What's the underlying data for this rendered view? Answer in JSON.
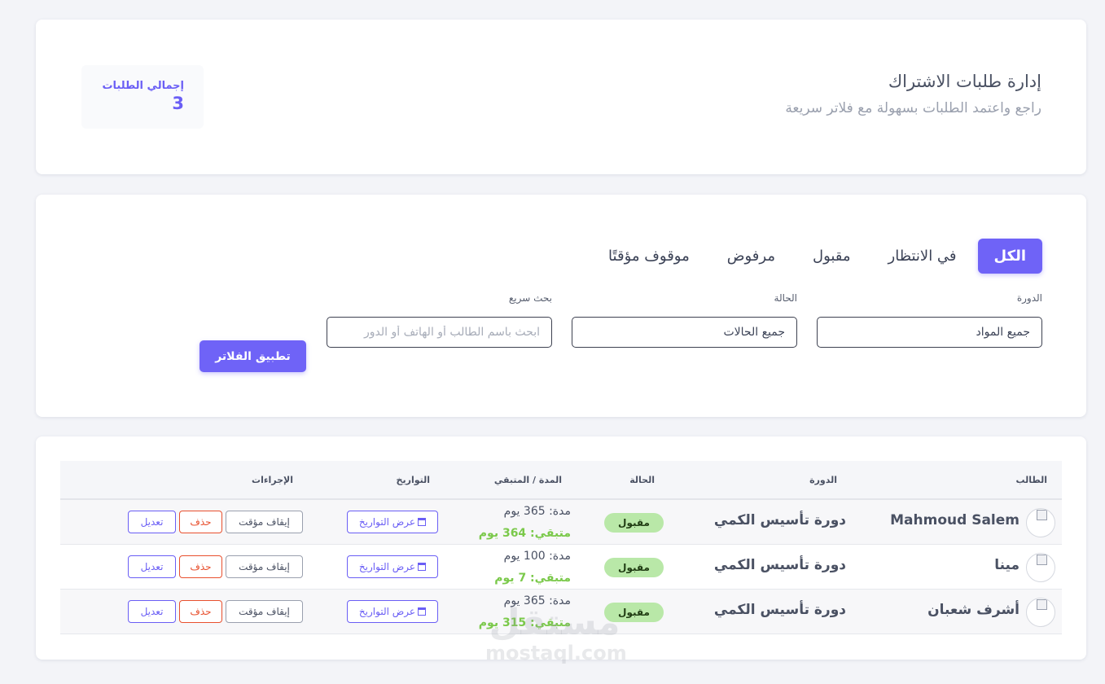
{
  "header": {
    "title": "إدارة طلبات الاشتراك",
    "subtitle": "راجع واعتمد الطلبات بسهولة مع فلاتر سريعة",
    "total_label": "إجمالي الطلبات",
    "total_value": "3"
  },
  "tabs": [
    {
      "label": "الكل",
      "active": true
    },
    {
      "label": "في الانتظار",
      "active": false
    },
    {
      "label": "مقبول",
      "active": false
    },
    {
      "label": "مرفوض",
      "active": false
    },
    {
      "label": "موقوف مؤقتًا",
      "active": false
    }
  ],
  "filters": {
    "course_label": "الدورة",
    "course_value": "جميع المواد",
    "status_label": "الحالة",
    "status_value": "جميع الحالات",
    "search_label": "بحث سريع",
    "search_placeholder": "ابحث باسم الطالب أو الهاتف أو الدور",
    "apply_label": "تطبيق الفلاتر"
  },
  "table": {
    "headers": {
      "student": "الطالب",
      "course": "الدورة",
      "status": "الحالة",
      "duration": "المدة / المتبقي",
      "dates": "التواريخ",
      "actions": "الإجراءات"
    },
    "rows": [
      {
        "student": "Mahmoud Salem",
        "course": "دورة تأسيس الكمي",
        "status": "مقبول",
        "duration": "مدة: 365 يوم",
        "remaining": "متبقي: 364 يوم",
        "dates": "عرض التواريخ",
        "pause": "إيقاف مؤقت",
        "delete": "حذف",
        "edit": "تعديل"
      },
      {
        "student": "مينا",
        "course": "دورة تأسيس الكمي",
        "status": "مقبول",
        "duration": "مدة: 100 يوم",
        "remaining": "متبقي: 7 يوم",
        "dates": "عرض التواريخ",
        "pause": "إيقاف مؤقت",
        "delete": "حذف",
        "edit": "تعديل"
      },
      {
        "student": "أشرف شعبان",
        "course": "دورة تأسيس الكمي",
        "status": "مقبول",
        "duration": "مدة: 365 يوم",
        "remaining": "متبقي: 315 يوم",
        "dates": "عرض التواريخ",
        "pause": "إيقاف مؤقت",
        "delete": "حذف",
        "edit": "تعديل"
      }
    ]
  },
  "watermark": {
    "ar": "مستقل",
    "en": "mostaql.com"
  },
  "colors": {
    "accent": "#6f63f7",
    "success_badge": "#b9e8a8",
    "remaining": "#7bc94b",
    "danger": "#e8502e"
  }
}
